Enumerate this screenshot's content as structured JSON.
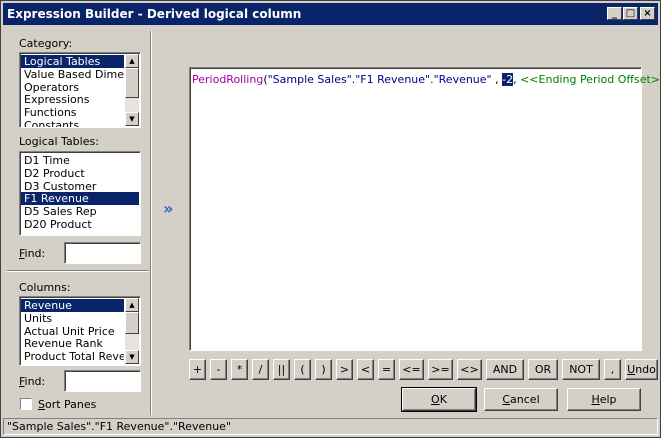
{
  "window": {
    "title": "Expression Builder - Derived logical column"
  },
  "titlebar_buttons": {
    "minimize": "_",
    "maximize": "□",
    "close": "×"
  },
  "category": {
    "label": "Category:",
    "items": [
      "Logical Tables",
      "Value Based Dimensions",
      "Operators",
      "Expressions",
      "Functions",
      "Constants"
    ],
    "selected": "Logical Tables"
  },
  "logical_tables": {
    "label": "Logical Tables:",
    "items": [
      "D1 Time",
      "D2 Product",
      "D3 Customer",
      "F1 Revenue",
      "D5 Sales Rep",
      "D20 Product"
    ],
    "selected": "F1 Revenue"
  },
  "find1": {
    "label": "Find:",
    "value": ""
  },
  "columns": {
    "label": "Columns:",
    "items": [
      "Revenue",
      "Units",
      "Actual Unit Price",
      "Revenue Rank",
      "Product Total Revenue"
    ],
    "selected": "Revenue"
  },
  "find2": {
    "label": "Find:",
    "value": ""
  },
  "sort_panes": {
    "label": "Sort Panes",
    "checked": false
  },
  "insert_arrow": "»",
  "expression": {
    "function": "PeriodRolling",
    "open": "(",
    "arg1": "\"Sample Sales\".\"F1 Revenue\".\"Revenue\"",
    "sep1": " , ",
    "arg2": "-2",
    "sep2": ", ",
    "arg3": "<<Ending Period Offset>>",
    "close": ")"
  },
  "operators": [
    "+",
    "-",
    "*",
    "/",
    "||",
    "(",
    ")",
    ">",
    "<",
    "=",
    "<=",
    ">=",
    "<>",
    "AND",
    "OR",
    "NOT",
    ",",
    "Undo"
  ],
  "buttons": {
    "ok": "OK",
    "cancel": "Cancel",
    "help": "Help"
  },
  "status": "\"Sample Sales\".\"F1 Revenue\".\"Revenue\""
}
